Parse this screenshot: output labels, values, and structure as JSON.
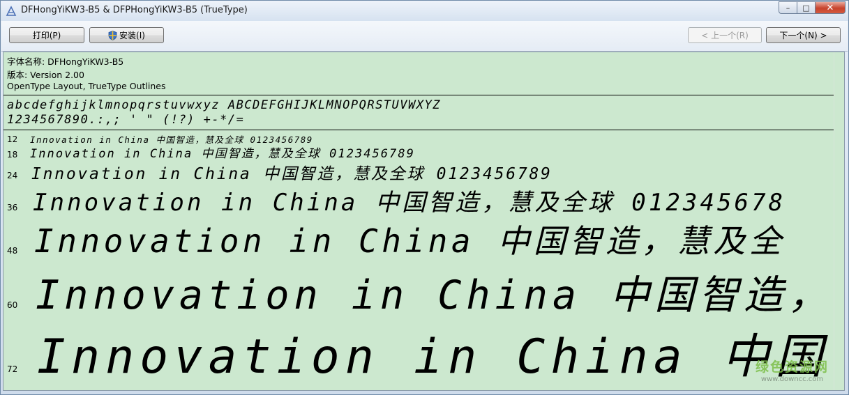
{
  "window": {
    "title": "DFHongYiKW3-B5 & DFPHongYiKW3-B5  (TrueType)",
    "minimize_glyph": "–",
    "maximize_glyph": "□",
    "close_glyph": "✕"
  },
  "toolbar": {
    "print_label": "打印(P)",
    "install_label": "安装(I)",
    "prev_label": "< 上一个(R)",
    "next_label": "下一个(N) >"
  },
  "font_info": {
    "name_line": "字体名称: DFHongYiKW3-B5",
    "version_line": "版本: Version 2.00",
    "type_line": "OpenType Layout, TrueType Outlines"
  },
  "charset": {
    "line1": "abcdefghijklmnopqrstuvwxyz ABCDEFGHIJKLMNOPQRSTUVWXYZ",
    "line2": "1234567890.:,; ' \" (!?) +-*/="
  },
  "samples": [
    {
      "size": "12",
      "text": "Innovation in China 中国智造，慧及全球 0123456789"
    },
    {
      "size": "18",
      "text": "Innovation in China 中国智造，慧及全球 0123456789"
    },
    {
      "size": "24",
      "text": "Innovation in China 中国智造，慧及全球 0123456789"
    },
    {
      "size": "36",
      "text": "Innovation in China 中国智造，慧及全球 012345678"
    },
    {
      "size": "48",
      "text": "Innovation in China 中国智造，慧及全"
    },
    {
      "size": "60",
      "text": "Innovation in China 中国智造，"
    },
    {
      "size": "72",
      "text": "Innovation in China 中国"
    }
  ],
  "watermark": {
    "main": "绿色资源网",
    "url": "www.downcc.com"
  },
  "colors": {
    "content_bg": "#cce8cf",
    "titlebar": "#dbe7f4",
    "close_button": "#c7422c"
  }
}
